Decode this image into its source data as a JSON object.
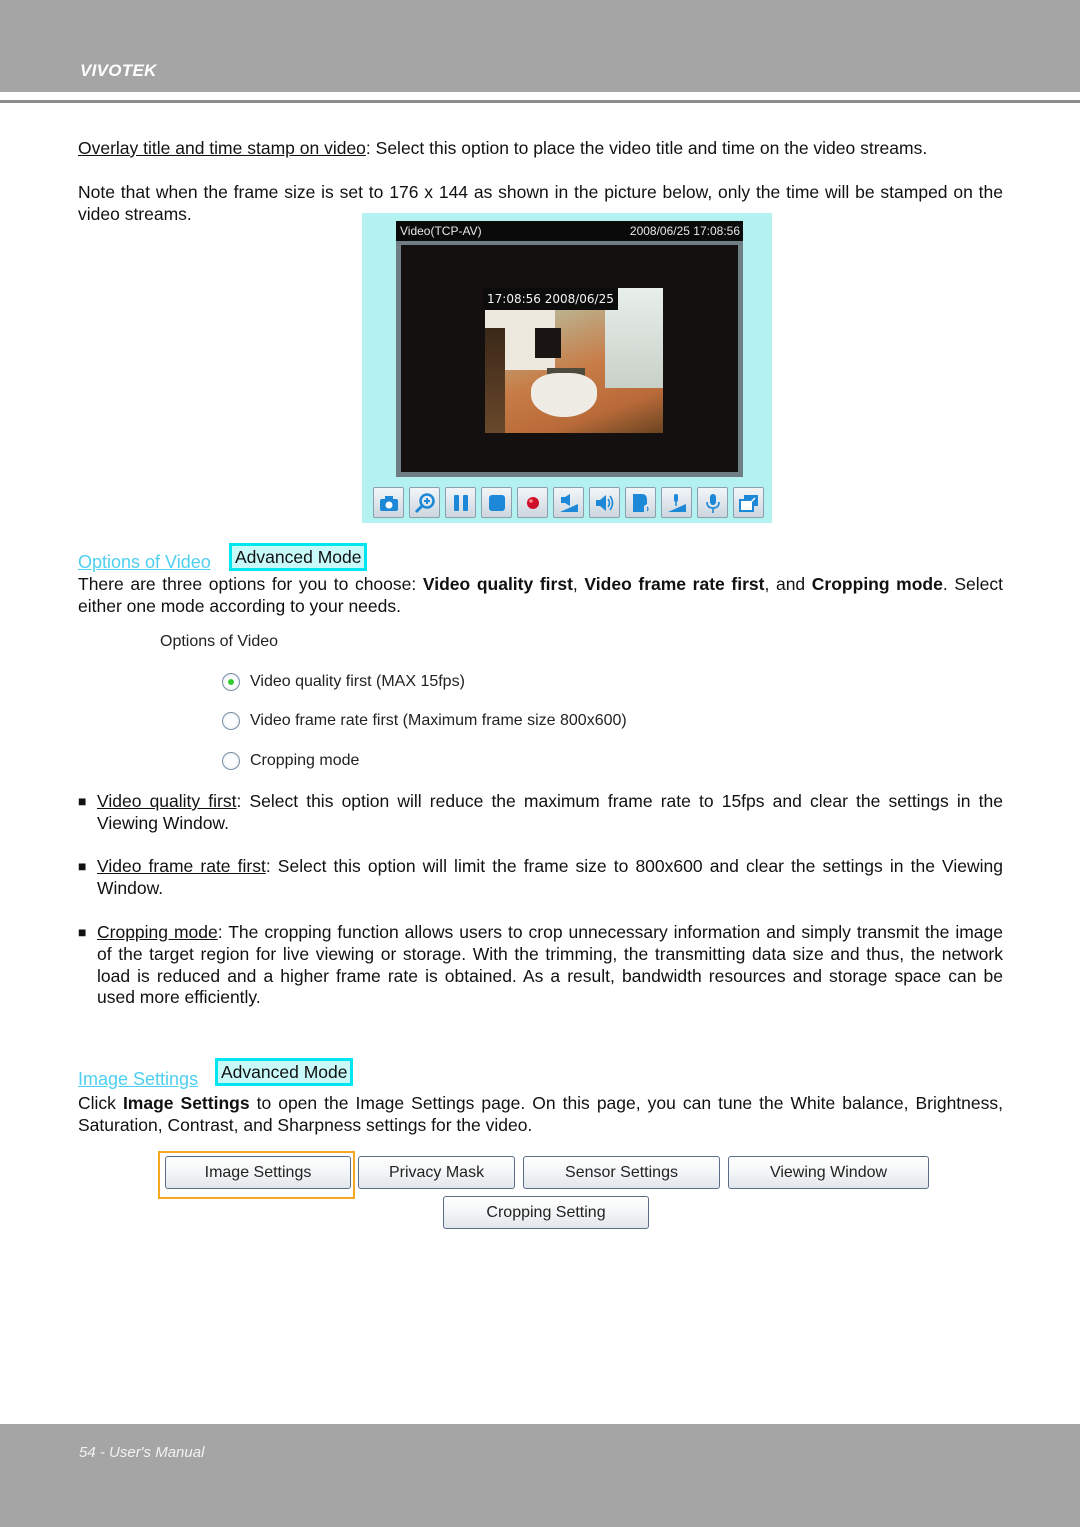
{
  "header": {
    "brand": "VIVOTEK"
  },
  "footer": {
    "page_label": "54 - User's Manual"
  },
  "intro": {
    "overlay_link": "Overlay title and time stamp on video",
    "overlay_text": ": Select this option to place the video title and time on the video streams.",
    "note_text": "Note that when the frame size is set to 176 x 144 as shown in the picture below, only the time will be stamped on the video streams."
  },
  "viewer": {
    "title": "Video(TCP-AV)",
    "timestamp": "2008/06/25 17:08:56",
    "overlay_stamp": "17:08:56 2008/06/25",
    "controls": [
      {
        "name": "snapshot-button",
        "icon": "camera-icon"
      },
      {
        "name": "digital-zoom-button",
        "icon": "zoom-in-icon"
      },
      {
        "name": "pause-button",
        "icon": "pause-icon"
      },
      {
        "name": "stop-button",
        "icon": "stop-icon"
      },
      {
        "name": "record-button",
        "icon": "record-icon"
      },
      {
        "name": "volume-button",
        "icon": "volume-icon"
      },
      {
        "name": "mute-button",
        "icon": "speaker-icon"
      },
      {
        "name": "talk-button",
        "icon": "talk-icon"
      },
      {
        "name": "mic-volume-button",
        "icon": "mic-volume-icon"
      },
      {
        "name": "mic-mute-button",
        "icon": "microphone-icon"
      },
      {
        "name": "fullscreen-button",
        "icon": "fullscreen-icon"
      }
    ]
  },
  "options_section": {
    "heading": "Options of Video",
    "badge": "Advanced Mode",
    "desc_pre": "There are three options for you to choose: ",
    "desc_b1": "Video quality first",
    "desc_sep1": ", ",
    "desc_b2": "Video frame rate first",
    "desc_sep2": ", and ",
    "desc_b3": "Cropping mode",
    "desc_post": ". Select either one mode according to your needs.",
    "panel_title": "Options of Video",
    "radios": [
      {
        "label": "Video quality first (MAX 15fps)",
        "checked": true
      },
      {
        "label": "Video frame rate first (Maximum frame size 800x600)",
        "checked": false
      },
      {
        "label": "Cropping mode",
        "checked": false
      }
    ],
    "bullets": [
      {
        "term": "Video quality first",
        "text": ": Select this option will reduce the maximum frame rate to 15fps and clear the settings in the Viewing Window."
      },
      {
        "term": "Video frame rate first",
        "text": ": Select this option will limit the frame size to 800x600 and clear the settings in the Viewing Window."
      },
      {
        "term": "Cropping mode",
        "text": ": The cropping function allows users to crop unnecessary information and simply transmit the image of the target region for live viewing or storage. With the trimming, the transmitting data size and thus, the network load is reduced and a higher frame rate is obtained. As a result, bandwidth resources and storage space can be used more efficiently."
      }
    ],
    "bullet_glyph": "■"
  },
  "image_section": {
    "heading": "Image Settings",
    "badge": "Advanced Mode",
    "desc_pre": "Click ",
    "desc_b": "Image Settings",
    "desc_post": " to open the Image Settings page. On this page, you can tune the White balance, Brightness, Saturation, Contrast, and Sharpness settings for the video.",
    "buttons": [
      "Image Settings",
      "Privacy Mask",
      "Sensor Settings",
      "Viewing Window",
      "Cropping Setting"
    ],
    "highlight_color": "#f5a623"
  },
  "colors": {
    "link": "#4dd0f0",
    "badge_border": "#00e5ef",
    "header_bg": "#a5a5a5",
    "viewer_bg": "#b4f2f2"
  }
}
